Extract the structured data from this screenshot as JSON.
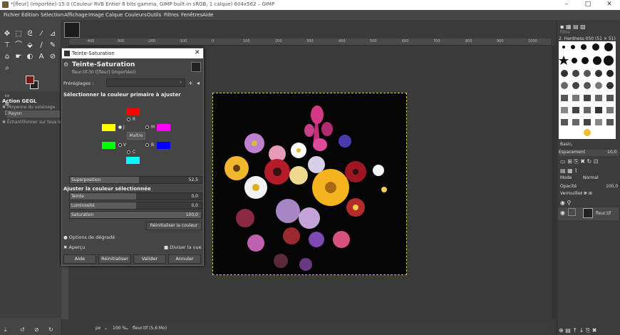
{
  "window": {
    "title": "*[fleur] (importée)-15.0 (Couleur RVB Entier 8 bits gamma, GIMP built-in sRGB, 1 calque) 604x562 – GIMP",
    "min": "–",
    "max": "□",
    "close": "✕"
  },
  "menu": [
    "Fichier",
    "Édition",
    "Sélection",
    "Affichage",
    "Image",
    "Calque",
    "Couleurs",
    "Outils",
    "Filtres",
    "Fenêtres",
    "Aide"
  ],
  "toolbox": {
    "gegl_title": "Action GEGL",
    "gegl_rows": [
      "Moyenne du voisinage",
      "Rayon",
      "Échantillonner sur tous les"
    ],
    "fg_color": "#7a1c12",
    "bg_color": "#222222"
  },
  "dialog": {
    "window_title": "Teinte-Saturation",
    "heading": "Teinte-Saturation",
    "subtitle": "fleur.tif-30 ([fleur] (importée))",
    "presets_label": "Préréglages :",
    "primary_title": "Sélectionner la couleur primaire à ajuster",
    "colors": [
      {
        "key": "R",
        "hex": "#ff0000"
      },
      {
        "key": "J",
        "hex": "#ffff00"
      },
      {
        "key": "M",
        "hex": "#ff00ff"
      },
      {
        "key": "V",
        "hex": "#00ff00"
      },
      {
        "key": "B",
        "hex": "#0000ff"
      },
      {
        "key": "C",
        "hex": "#00ffff"
      }
    ],
    "master_label": "Maître",
    "overlap": {
      "label": "Superposition",
      "value": "52,5",
      "fraction": 0.525
    },
    "adjust_title": "Ajuster la couleur sélectionnée",
    "hue": {
      "label": "Teinte",
      "value": "0,0",
      "fraction": 0.5
    },
    "lightness": {
      "label": "Luminosité",
      "value": "0,0",
      "fraction": 0.5
    },
    "saturation": {
      "label": "Saturation",
      "value": "100,0",
      "fraction": 0.995
    },
    "reset_color": "Réinitialiser la couleur",
    "blend_options": "Options de dégradé",
    "preview": "Aperçu",
    "split_view": "Diviser la vue",
    "buttons": [
      "Aide",
      "Réinitialiser",
      "Valider",
      "Annuler"
    ]
  },
  "status": {
    "unit": "px",
    "zoom": "100 %",
    "file": "fleur.tif (5,6 Mo)"
  },
  "ruler_labels": [
    "-400",
    "-300",
    "-200",
    "-100",
    "0",
    "100",
    "200",
    "300",
    "400",
    "500",
    "600",
    "700",
    "800",
    "900",
    "1000"
  ],
  "dock": {
    "filter": "filtre",
    "brush_name": "2. Hardness 050 (51 × 51)",
    "tag": "Basic,",
    "spacing_label": "Espacement",
    "spacing_value": "10,0",
    "mode_label": "Mode",
    "mode_value": "Normal",
    "opacity_label": "Opacité",
    "opacity_value": "100,0",
    "lock_label": "Verrouiller :",
    "layer_name": "fleur.tif"
  }
}
